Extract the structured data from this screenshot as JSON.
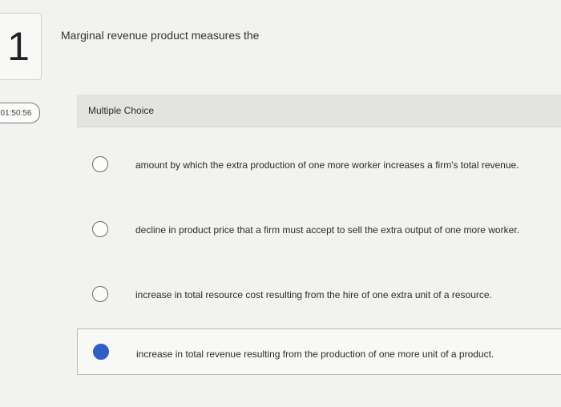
{
  "question": {
    "number": "1",
    "text": "Marginal revenue product measures the"
  },
  "timer": {
    "value": "01:50:56"
  },
  "section": {
    "label": "Multiple Choice"
  },
  "choices": [
    {
      "text": "amount by which the extra production of one more worker increases a firm's total revenue.",
      "selected": false
    },
    {
      "text": "decline in product price that a firm must accept to sell the extra output of one more worker.",
      "selected": false
    },
    {
      "text": "increase in total resource cost resulting from the hire of one extra unit of a resource.",
      "selected": false
    },
    {
      "text": "increase in total revenue resulting from the production of one more unit of a product.",
      "selected": true
    }
  ],
  "colors": {
    "selected_radio": "#2f5fc4"
  }
}
